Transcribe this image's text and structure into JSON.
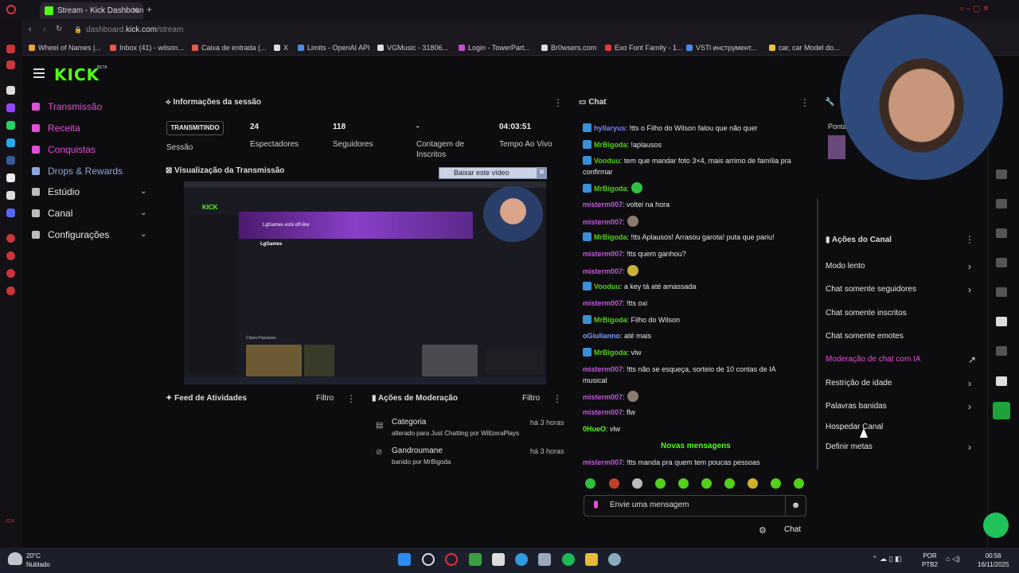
{
  "browser": {
    "tab_title": "Stream - Kick Dashboard",
    "url_prefix": "dashboard.",
    "url_host": "kick.com",
    "url_path": "/stream",
    "bookmarks": [
      "Wheel of Names |...",
      "Inbox (41) - wilson...",
      "Caixa de entrada (...",
      "X",
      "Limits - OpenAI API",
      "VGMusic - 31806...",
      "Login - TowerPart...",
      "Br0wsers.com",
      "Exo Font Family - 1...",
      "VSTi инструмент...",
      "car, car Model do..."
    ]
  },
  "header": {
    "logo": "KICK",
    "beta": "BETA"
  },
  "sidebar": {
    "items": [
      {
        "label": "Transmissão",
        "active": true
      },
      {
        "label": "Receita"
      },
      {
        "label": "Conquistas"
      },
      {
        "label": "Drops & Rewards"
      },
      {
        "label": "Estúdio"
      },
      {
        "label": "Canal"
      },
      {
        "label": "Configurações"
      }
    ]
  },
  "session": {
    "title": "Informações da sessão",
    "badge": "TRANSMITINDO",
    "badge_label": "Sessão",
    "viewers_value": "24",
    "viewers_label": "Espectadores",
    "followers_value": "118",
    "followers_label": "Seguidores",
    "subs_value": "-",
    "subs_label": "Contagem de Inscritos",
    "uptime_value": "04:03:51",
    "uptime_label": "Tempo Ao Vivo"
  },
  "preview": {
    "title": "Visualização da Transmissão",
    "download_label": "Baixar este vídeo",
    "offline_text": "LgGames está off-line",
    "channel_name": "LgGames",
    "popular_clips": "Clipes Populares"
  },
  "activity": {
    "title": "Feed de Atividades",
    "filter": "Filtro"
  },
  "moderation": {
    "title": "Ações de Moderação",
    "filter": "Filtro",
    "items": [
      {
        "title": "Categoria",
        "sub": "alterado para Just Chatting por WillzeraPlays",
        "time": "há 3 horas"
      },
      {
        "title": "Gandroumane",
        "sub": "banido por MrBigoda",
        "time": "há 3 horas"
      }
    ]
  },
  "chat": {
    "title": "Chat",
    "messages": [
      {
        "user": "hyllaryus",
        "text": ": !tts o Filho do Wilson falou que não quer",
        "color": "#7a7dfb",
        "badge": true
      },
      {
        "user": "MrBigoda",
        "text": ": !aplausos",
        "color": "#53d01a",
        "badge": true
      },
      {
        "user": "Vooduu",
        "text": ": tem que mandar foto 3×4, mais arrimo de família pra confirmar",
        "color": "#53d01a",
        "badge": true
      },
      {
        "user": "MrBigoda",
        "text": ":",
        "color": "#53d01a",
        "badge": true,
        "emote": "#2fbf3f"
      },
      {
        "user": "misterm007",
        "text": ": voltei na hora",
        "color": "#c15ad9"
      },
      {
        "user": "misterm007",
        "text": ":",
        "color": "#c15ad9",
        "emote": "#8a7a70"
      },
      {
        "user": "MrBigoda",
        "text": ": !tts Aplausos! Arrasou garota! puta que pariu!",
        "color": "#53d01a",
        "badge": true
      },
      {
        "user": "misterm007",
        "text": ": !tts quem ganhou?",
        "color": "#c15ad9"
      },
      {
        "user": "misterm007",
        "text": ":",
        "color": "#c15ad9",
        "emote": "#c9b13a"
      },
      {
        "user": "Vooduu",
        "text": ": a key tá até amassada",
        "color": "#53d01a",
        "badge": true
      },
      {
        "user": "misterm007",
        "text": ": !tts oxi",
        "color": "#c15ad9"
      },
      {
        "user": "MrBigoda",
        "text": ": Filho do Wilson",
        "color": "#53d01a",
        "badge": true
      },
      {
        "user": "oGiulianno",
        "text": ": até mais",
        "color": "#7a9dfb"
      },
      {
        "user": "MrBigoda",
        "text": ": vlw",
        "color": "#53d01a",
        "badge": true
      },
      {
        "user": "misterm007",
        "text": ": !tts não se esqueça, sorteio de 10 contas de IA musical",
        "color": "#c15ad9"
      },
      {
        "user": "misterm007",
        "text": ":",
        "color": "#c15ad9",
        "emote": "#8a7a70"
      },
      {
        "user": "misterm007",
        "text": ": flw",
        "color": "#c15ad9"
      },
      {
        "user": "0HueO",
        "text": ": vlw",
        "color": "#53fc18"
      }
    ],
    "new_messages": "Novas mensagens",
    "last_message": {
      "user": "misterm007",
      "text": ": !tts manda pra quem tem poucas pessoas",
      "color": "#c15ad9"
    },
    "input_placeholder": "Envie uma mensagem",
    "send_label": "Chat"
  },
  "actions": {
    "title": "Ações do Canal",
    "items": [
      {
        "label": "Modo lento",
        "arrow": true
      },
      {
        "label": "Chat somente seguidores",
        "arrow": true
      },
      {
        "label": "Chat somente inscritos"
      },
      {
        "label": "Chat somente emotes"
      },
      {
        "label": "Moderação de chat com IA",
        "ai": true
      },
      {
        "label": "Restrição de idade",
        "arrow": true
      },
      {
        "label": "Palavras banidas",
        "arrow": true
      },
      {
        "label": "Hospedar Canal"
      },
      {
        "label": "Definir metas",
        "arrow": true
      }
    ],
    "partial_label": "Ponta"
  },
  "taskbar": {
    "temp": "20°C",
    "weather": "Nublado",
    "lang1": "POR",
    "lang2": "PTB2",
    "time": "00:56",
    "date": "16/11/2025"
  },
  "colors": {
    "accent": "#53fc18",
    "pink": "#e24fd4",
    "bg": "#0d0d0f"
  }
}
